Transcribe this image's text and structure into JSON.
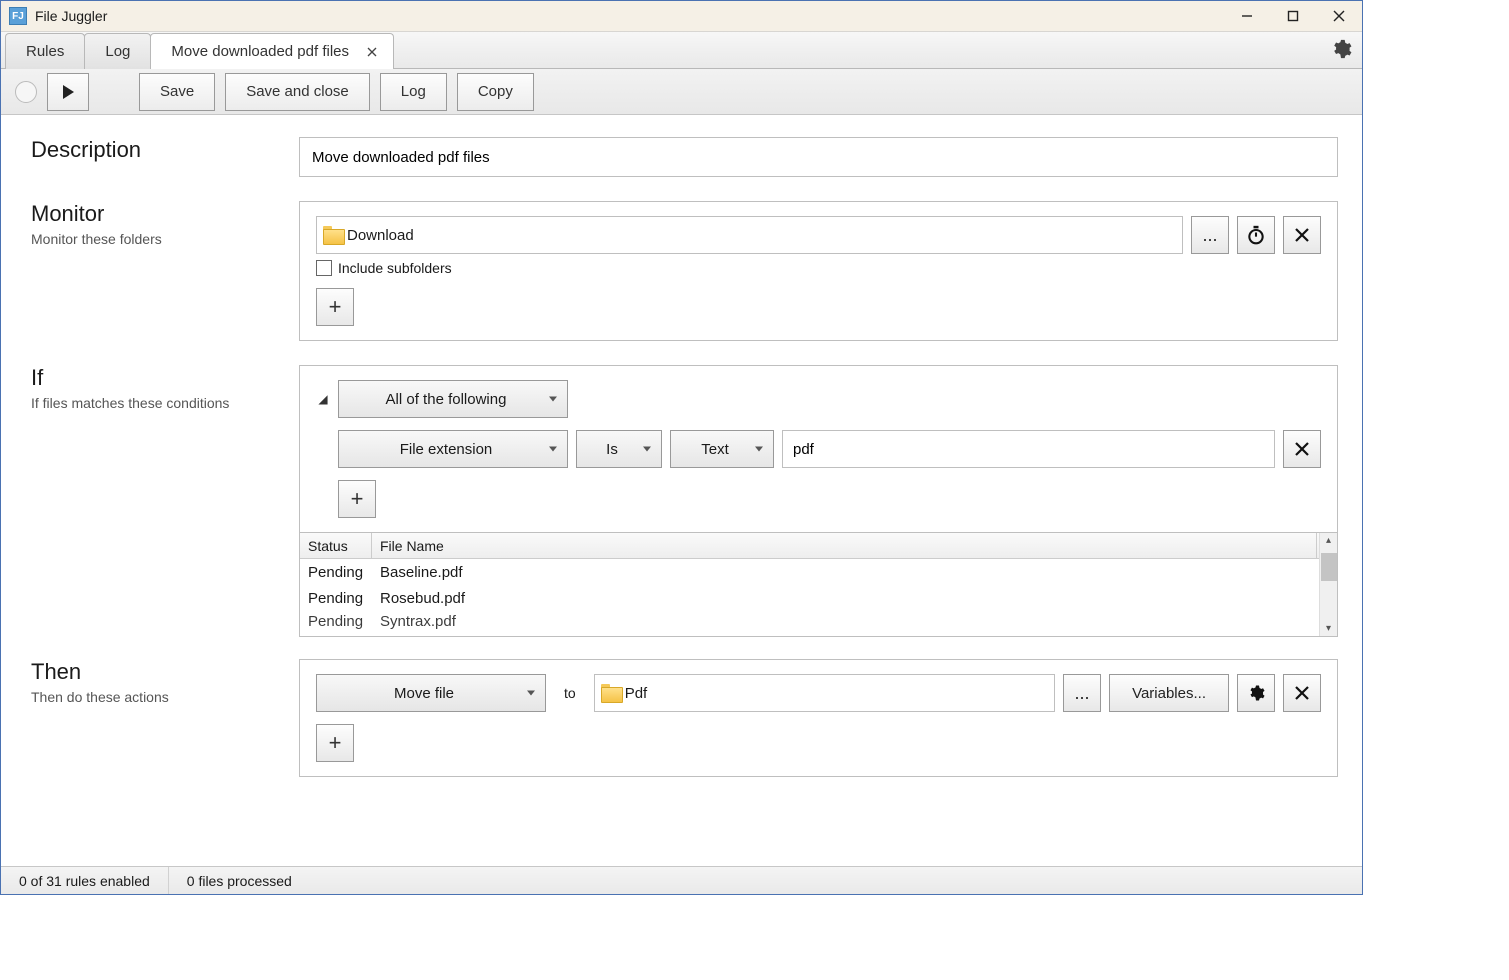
{
  "window": {
    "title": "File Juggler"
  },
  "tabs": {
    "rules": "Rules",
    "log": "Log",
    "active": "Move downloaded pdf files"
  },
  "toolbar": {
    "save": "Save",
    "save_close": "Save and close",
    "log": "Log",
    "copy": "Copy"
  },
  "sections": {
    "description": {
      "title": "Description"
    },
    "monitor": {
      "title": "Monitor",
      "sub": "Monitor these folders"
    },
    "if": {
      "title": "If",
      "sub": "If files matches these conditions"
    },
    "then": {
      "title": "Then",
      "sub": "Then do these actions"
    }
  },
  "description_value": "Move downloaded pdf files",
  "monitor": {
    "folder": "Download",
    "browse": "...",
    "include_sub": "Include subfolders"
  },
  "if": {
    "group_mode": "All of the following",
    "field": "File extension",
    "op": "Is",
    "type": "Text",
    "value": "pdf"
  },
  "status_list": {
    "col_status": "Status",
    "col_name": "File Name",
    "rows": [
      {
        "status": "Pending",
        "name": "Baseline.pdf"
      },
      {
        "status": "Pending",
        "name": "Rosebud.pdf"
      },
      {
        "status": "Pending",
        "name": "Syntrax.pdf"
      }
    ]
  },
  "then": {
    "action": "Move file",
    "to_label": "to",
    "folder": "Pdf",
    "browse": "...",
    "variables": "Variables..."
  },
  "statusbar": {
    "rules": "0 of 31 rules enabled",
    "files": "0 files processed"
  }
}
